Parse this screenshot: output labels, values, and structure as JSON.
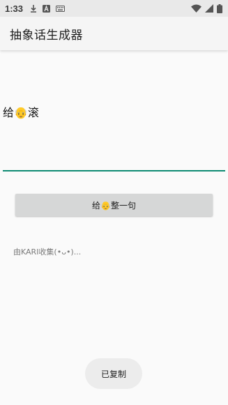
{
  "status_bar": {
    "time": "1:33",
    "icons": [
      "download-icon",
      "a-square-icon",
      "keyboard-icon",
      "wifi-icon",
      "signal-icon",
      "battery-icon"
    ]
  },
  "app_bar": {
    "title": "抽象话生成器"
  },
  "output": {
    "text": "给👴滚"
  },
  "generate_button": {
    "label": "给👴整一句"
  },
  "credit": {
    "text": "由KARI收集(•ᴗ•)..."
  },
  "toast": {
    "text": "已复制"
  },
  "colors": {
    "accent": "#0d8a72",
    "button_bg": "#d6d7d7",
    "background": "#fafafa",
    "app_bar_bg": "#f5f5f5",
    "status_bar_bg": "#e9e9e9"
  }
}
